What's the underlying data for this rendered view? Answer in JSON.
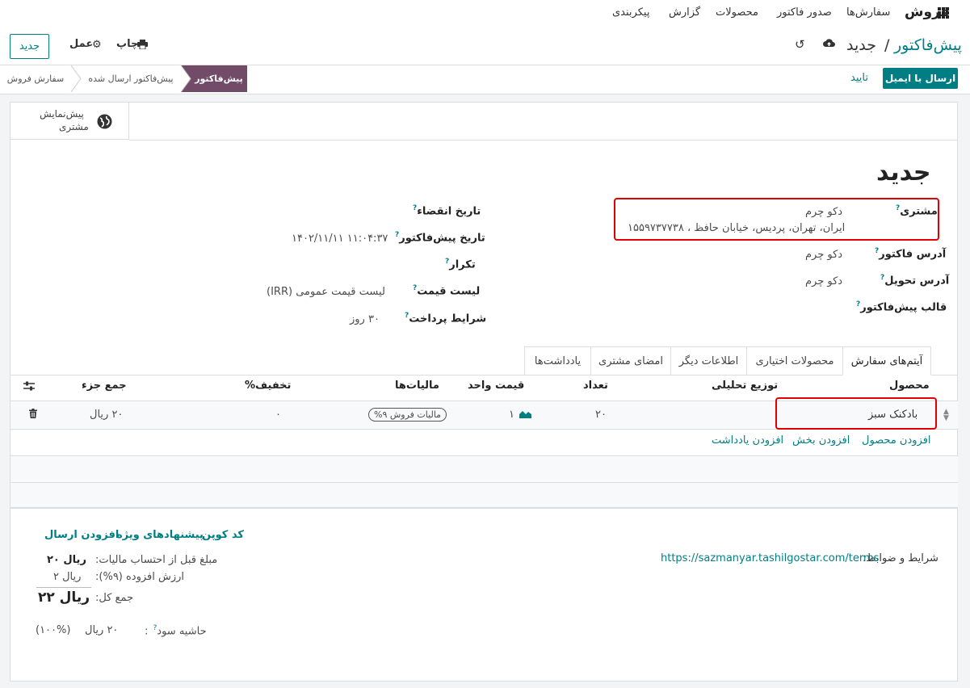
{
  "navbar": {
    "app_name": "فروش",
    "menu": [
      "سفارش‌ها",
      "صدور فاکتور",
      "محصولات",
      "گزارش",
      "پیکربندی"
    ]
  },
  "control_panel": {
    "new_button": "جدید",
    "breadcrumb_parent": "پیش‌فاکتور",
    "breadcrumb_sep": "/",
    "breadcrumb_current": "جدید",
    "print": "چاپ",
    "action": "عمل"
  },
  "status_row": {
    "send_email": "ارسال با ایمیل",
    "confirm": "تایید",
    "stages": [
      "پیش‌فاکتور",
      "پیش‌فاکتور ارسال شده",
      "سفارش فروش"
    ]
  },
  "smart_button": {
    "label_line1": "پیش‌نمایش",
    "label_line2": "مشتری"
  },
  "form": {
    "title": "جدید",
    "customer_label": "مشتری",
    "customer_name": "دکو چرم",
    "customer_address": "ایران، تهران، پردیس، خیابان حافظ ، ۱۵۵۹۷۳۷۷۳۸",
    "invoice_address_label": "آدرس فاکتور",
    "invoice_address": "دکو چرم",
    "delivery_address_label": "آدرس تحویل",
    "delivery_address": "دکو چرم",
    "quotation_template_label": "قالب پیش‌فاکتور",
    "expiration_label": "تاریخ انقضاء",
    "quotation_date_label": "تاریخ پیش‌فاکتور",
    "quotation_date": "۱۴۰۲/۱۱/۱۱ ۱۱:۰۴:۳۷",
    "recurrence_label": "تکرار",
    "pricelist_label": "لیست قیمت",
    "pricelist": "لیست قیمت عمومی (IRR)",
    "payment_terms_label": "شرایط پرداخت",
    "payment_terms": "۳۰ روز"
  },
  "tabs": [
    "آیتم‌های سفارش",
    "محصولات اختیاری",
    "اطلاعات دیگر",
    "امضای مشتری",
    "یادداشت‌ها"
  ],
  "order_table": {
    "headers": {
      "product": "محصول",
      "analytic": "توزیع تحلیلی",
      "quantity": "تعداد",
      "unit_price": "قیمت واحد",
      "taxes": "مالیات‌ها",
      "discount": "تخفیف%",
      "subtotal": "جمع جزء"
    },
    "rows": [
      {
        "product": "بادکنک سبز",
        "quantity": "۲۰",
        "unit_price": "۱",
        "tax": "مالیات فروش ۹%",
        "discount": "۰",
        "subtotal": "۲۰ ریال"
      }
    ],
    "add_product": "افزودن محصول",
    "add_section": "افزودن بخش",
    "add_note": "افزودن یادداشت"
  },
  "footer": {
    "terms_label": "شرایط و ضوابط:",
    "terms_url": "https://sazmanyar.tashilgostar.com/terms",
    "coupon": "کد کوپن",
    "promotions": "پیشنهادهای ویژه",
    "add_shipping": "افزودن ارسال",
    "untaxed_label": "مبلغ قبل از احتساب مالیات:",
    "untaxed_value": "ریال ۲۰",
    "vat_label": "ارزش افزوده (۹%):",
    "vat_value": "ریال ۲",
    "total_label": "جمع کل:",
    "total_value": "ریال ۲۲",
    "margin_label": "حاشیه سود",
    "margin_value": "۲۰ ریال",
    "margin_percent": "(۱۰۰%)"
  },
  "colors": {
    "accent": "#017e84",
    "stage_active": "#714b67",
    "highlight": "#e00000"
  }
}
